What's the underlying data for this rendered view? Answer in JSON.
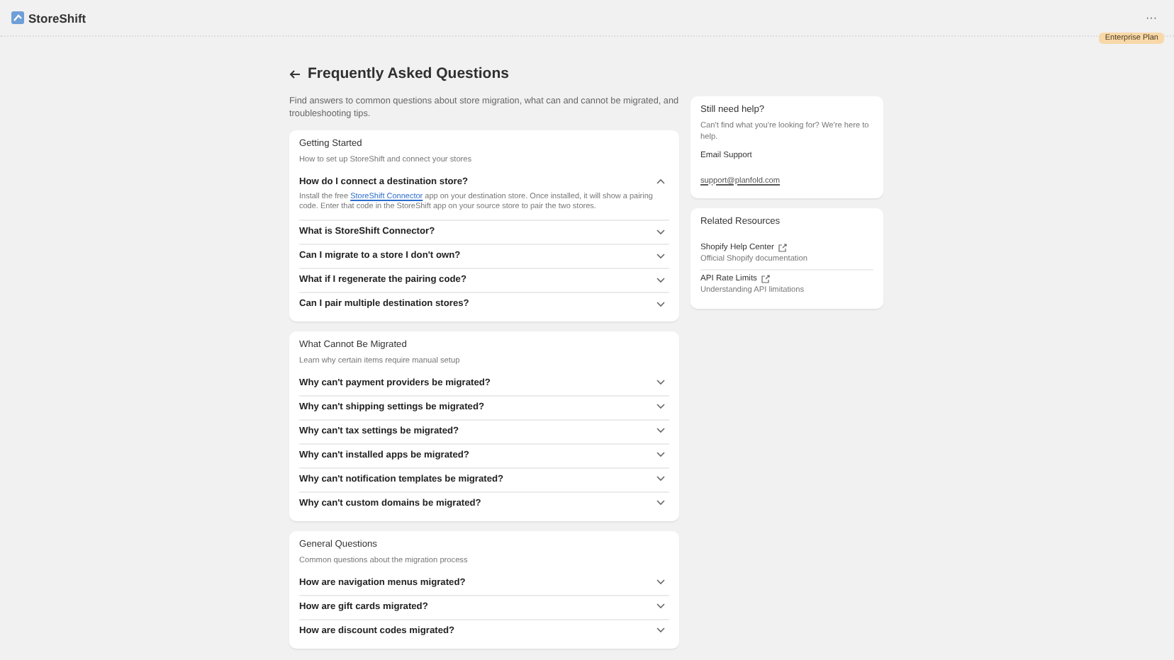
{
  "app": {
    "name": "StoreShift",
    "plan_badge": "Enterprise Plan",
    "menu": "···"
  },
  "page": {
    "title": "Frequently Asked Questions",
    "intro": "Find answers to common questions about store migration, what can and cannot be migrated, and troubleshooting tips."
  },
  "sections": [
    {
      "title": "Getting Started",
      "subtitle": "How to set up StoreShift and connect your stores",
      "questions": [
        {
          "question": "How do I connect a destination store?",
          "expanded": true,
          "answer": {
            "before": "Install the free ",
            "link": "StoreShift Connector",
            "after": " app on your destination store. Once installed, it will show a pairing code. Enter that code in the StoreShift app on your source store to pair the two stores."
          }
        },
        {
          "question": "What is StoreShift Connector?",
          "expanded": false
        },
        {
          "question": "Can I migrate to a store I don't own?",
          "expanded": false
        },
        {
          "question": "What if I regenerate the pairing code?",
          "expanded": false
        },
        {
          "question": "Can I pair multiple destination stores?",
          "expanded": false
        }
      ]
    },
    {
      "title": "What Cannot Be Migrated",
      "subtitle": "Learn why certain items require manual setup",
      "questions": [
        {
          "question": "Why can't payment providers be migrated?",
          "expanded": false
        },
        {
          "question": "Why can't shipping settings be migrated?",
          "expanded": false
        },
        {
          "question": "Why can't tax settings be migrated?",
          "expanded": false
        },
        {
          "question": "Why can't installed apps be migrated?",
          "expanded": false
        },
        {
          "question": "Why can't notification templates be migrated?",
          "expanded": false
        },
        {
          "question": "Why can't custom domains be migrated?",
          "expanded": false
        }
      ]
    },
    {
      "title": "General Questions",
      "subtitle": "Common questions about the migration process",
      "questions": [
        {
          "question": "How are navigation menus migrated?",
          "expanded": false
        },
        {
          "question": "How are gift cards migrated?",
          "expanded": false
        },
        {
          "question": "How are discount codes migrated?",
          "expanded": false
        }
      ]
    }
  ],
  "help": {
    "title": "Still need help?",
    "text": "Can't find what you're looking for? We're here to help.",
    "email_label": "Email Support",
    "email": "support@planfold.com"
  },
  "resources": {
    "title": "Related Resources",
    "items": [
      {
        "title": "Shopify Help Center",
        "subtitle": "Official Shopify documentation"
      },
      {
        "title": "API Rate Limits",
        "subtitle": "Understanding API limitations"
      }
    ]
  }
}
